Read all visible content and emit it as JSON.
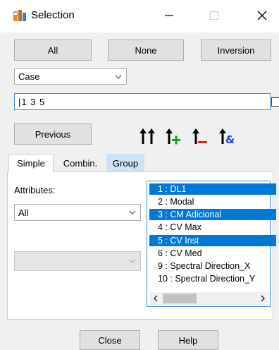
{
  "window": {
    "title": "Selection"
  },
  "buttons": {
    "all": "All",
    "none": "None",
    "inversion": "Inversion",
    "previous": "Previous",
    "close": "Close",
    "help": "Help"
  },
  "case_combo": {
    "value": "Case"
  },
  "selection_input": {
    "value": "|1 3 5"
  },
  "toolbar_icons": [
    "select-all-icon",
    "add-selection-icon",
    "remove-selection-icon",
    "intersect-selection-icon"
  ],
  "tabs": [
    {
      "label": "Simple",
      "active": true
    },
    {
      "label": "Combin.",
      "active": false
    },
    {
      "label": "Group",
      "active": false
    }
  ],
  "attributes": {
    "label": "Attributes:",
    "value": "All"
  },
  "list": {
    "items": [
      {
        "label": "1 : DL1",
        "selected": true
      },
      {
        "label": "2 : Modal",
        "selected": false
      },
      {
        "label": "3 : CM Adicional",
        "selected": true
      },
      {
        "label": "4 : CV Max",
        "selected": false
      },
      {
        "label": "5 : CV Inst",
        "selected": true
      },
      {
        "label": "6 : CV Med",
        "selected": false
      },
      {
        "label": "9 : Spectral  Direction_X",
        "selected": false
      },
      {
        "label": "10 : Spectral  Direction_Y",
        "selected": false
      }
    ]
  },
  "colors": {
    "selection": "#0078d7",
    "accent_border": "#3a8ee6",
    "add_icon": "#1a9e1a",
    "remove_icon": "#e02020",
    "intersect_icon": "#1f3fd8",
    "tab_group_bg": "#cde3f5"
  }
}
